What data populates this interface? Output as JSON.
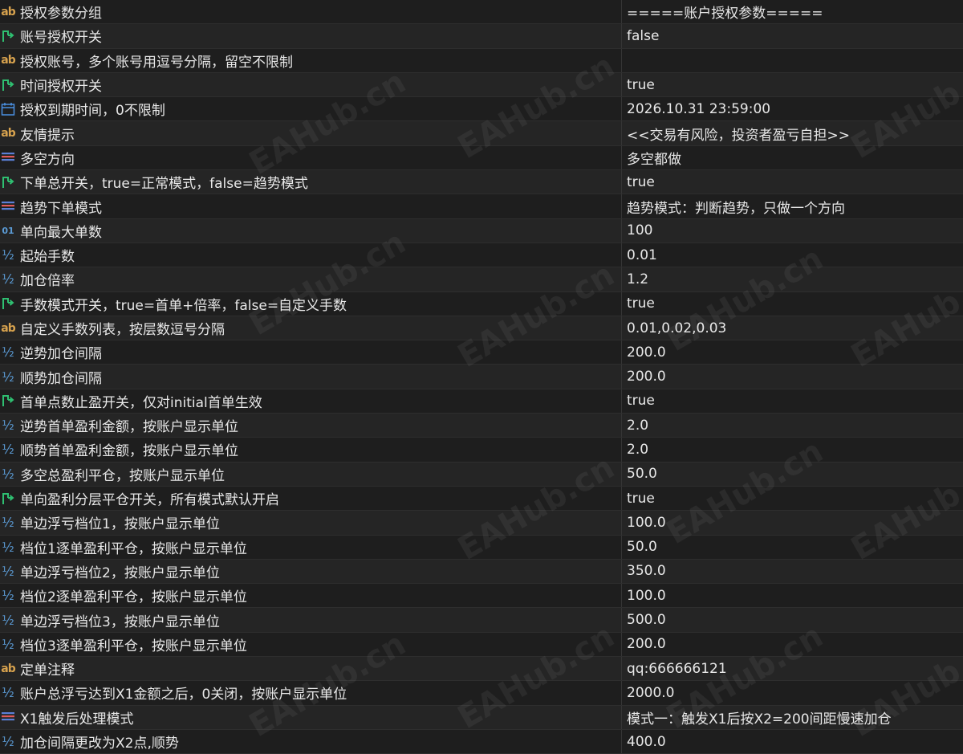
{
  "watermark": "EAHub.cn",
  "rows": [
    {
      "icon": "text-icon",
      "label": "授权参数分组",
      "value": "=====账户授权参数====="
    },
    {
      "icon": "toggle-icon",
      "label": "账号授权开关",
      "value": "false"
    },
    {
      "icon": "text-icon",
      "label": "授权账号，多个账号用逗号分隔，留空不限制",
      "value": ""
    },
    {
      "icon": "toggle-icon",
      "label": "时间授权开关",
      "value": "true"
    },
    {
      "icon": "calendar-icon",
      "label": "授权到期时间，0不限制",
      "value": "2026.10.31 23:59:00"
    },
    {
      "icon": "text-icon",
      "label": "友情提示",
      "value": "<<交易有风险，投资者盈亏自担>>"
    },
    {
      "icon": "enum-icon",
      "label": "多空方向",
      "value": "多空都做"
    },
    {
      "icon": "toggle-icon",
      "label": "下单总开关，true=正常模式，false=趋势模式",
      "value": "true"
    },
    {
      "icon": "enum-icon",
      "label": "趋势下单模式",
      "value": "趋势模式：判断趋势，只做一个方向"
    },
    {
      "icon": "integer-icon",
      "label": "单向最大单数",
      "value": "100"
    },
    {
      "icon": "double-icon",
      "label": "起始手数",
      "value": "0.01"
    },
    {
      "icon": "double-icon",
      "label": "加仓倍率",
      "value": "1.2"
    },
    {
      "icon": "toggle-icon",
      "label": "手数模式开关，true=首单+倍率，false=自定义手数",
      "value": "true"
    },
    {
      "icon": "text-icon",
      "label": "自定义手数列表，按层数逗号分隔",
      "value": "0.01,0.02,0.03"
    },
    {
      "icon": "double-icon",
      "label": "逆势加仓间隔",
      "value": "200.0"
    },
    {
      "icon": "double-icon",
      "label": "顺势加仓间隔",
      "value": "200.0"
    },
    {
      "icon": "toggle-icon",
      "label": "首单点数止盈开关，仅对initial首单生效",
      "value": "true"
    },
    {
      "icon": "double-icon",
      "label": "逆势首单盈利金额，按账户显示单位",
      "value": "2.0"
    },
    {
      "icon": "double-icon",
      "label": "顺势首单盈利金额，按账户显示单位",
      "value": "2.0"
    },
    {
      "icon": "double-icon",
      "label": "多空总盈利平仓，按账户显示单位",
      "value": "50.0"
    },
    {
      "icon": "toggle-icon",
      "label": "单向盈利分层平仓开关，所有模式默认开启",
      "value": "true"
    },
    {
      "icon": "double-icon",
      "label": "单边浮亏档位1，按账户显示单位",
      "value": "100.0"
    },
    {
      "icon": "double-icon",
      "label": "档位1逐单盈利平仓，按账户显示单位",
      "value": "50.0"
    },
    {
      "icon": "double-icon",
      "label": "单边浮亏档位2，按账户显示单位",
      "value": "350.0"
    },
    {
      "icon": "double-icon",
      "label": "档位2逐单盈利平仓，按账户显示单位",
      "value": "100.0"
    },
    {
      "icon": "double-icon",
      "label": "单边浮亏档位3，按账户显示单位",
      "value": "500.0"
    },
    {
      "icon": "double-icon",
      "label": "档位3逐单盈利平仓，按账户显示单位",
      "value": "200.0"
    },
    {
      "icon": "text-icon",
      "label": "定单注释",
      "value": "qq:666666121"
    },
    {
      "icon": "double-icon",
      "label": "账户总浮亏达到X1金额之后，0关闭，按账户显示单位",
      "value": "2000.0"
    },
    {
      "icon": "enum-icon",
      "label": "X1触发后处理模式",
      "value": "模式一：触发X1后按X2=200间距慢速加仓"
    },
    {
      "icon": "double-icon",
      "label": "加仓间隔更改为X2点,顺势",
      "value": "400.0"
    }
  ],
  "colors": {
    "background": "#1e1e1e",
    "text_icon": "#d7a24e",
    "toggle_icon": "#2fbf71",
    "calendar_icon": "#4a90e2",
    "enum_icon_red": "#e05a5a",
    "enum_icon_blue": "#5b7fd6",
    "number_icon": "#5b9bd5"
  }
}
